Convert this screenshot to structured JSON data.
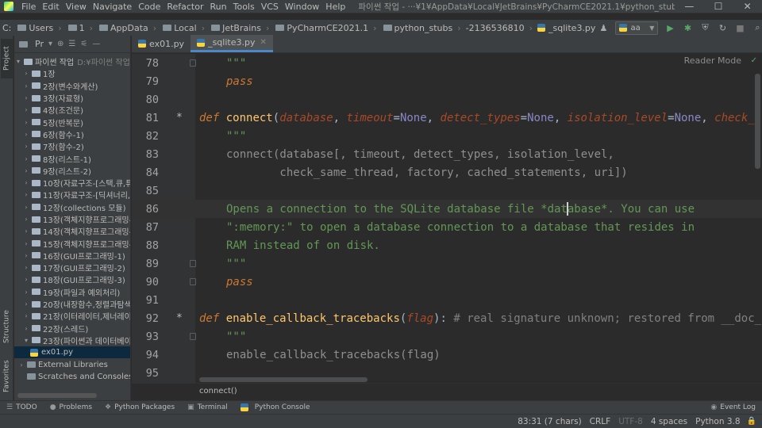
{
  "window": {
    "title": "파이썬 작업 - ···¥1¥AppData¥Local¥JetBrains¥PyCharmCE2021.1¥python_stubs¥-2136536810¥_sqlite3.py",
    "menu": [
      "File",
      "Edit",
      "View",
      "Navigate",
      "Code",
      "Refactor",
      "Run",
      "Tools",
      "VCS",
      "Window",
      "Help"
    ]
  },
  "breadcrumb": [
    "C:",
    "Users",
    "1",
    "AppData",
    "Local",
    "JetBrains",
    "PyCharmCE2021.1",
    "python_stubs",
    "-2136536810",
    "_sqlite3.py"
  ],
  "toolbar": {
    "run_config": "aa"
  },
  "left_strip": {
    "project": "Project",
    "structure": "Structure",
    "favorites": "Favorites"
  },
  "project": {
    "title": "Pr",
    "root": {
      "name": "파이썬 작업",
      "path": "D:¥파이썬 작업"
    },
    "folders": [
      "1장",
      "2장(변수와계산)",
      "3장(자료형)",
      "4장(조건문)",
      "5장(반복문)",
      "6장(함수-1)",
      "7장(함수-2)",
      "8장(리스트-1)",
      "9장(리스트-2)",
      "10장(자료구조-[스택,큐,튜플",
      "11장(자료구조-[딕셔너리,",
      "12장(collections 모듈)",
      "13장(객체지향프로그래밍-",
      "14장(객체지향프로그래밍-",
      "15장(객체지향프로그래밍-",
      "16장(GUI프로그래밍-1)",
      "17장(GUI프로그래밍-2)",
      "18장(GUI프로그래밍-3)",
      "19장(파일과 예외처리)",
      "20장(내장함수,정렬과탐색,",
      "21장(이터레이터,제너레이터",
      "22장(스레드)",
      "23장(파이썬과 데이터베이스"
    ],
    "selected_file": "ex01.py",
    "external": "External Libraries",
    "scratches": "Scratches and Consoles"
  },
  "tabs": [
    {
      "label": "ex01.py"
    },
    {
      "label": "_sqlite3.py"
    }
  ],
  "editor": {
    "reader_mode": "Reader Mode",
    "breadcrumb_func": "connect()",
    "line_numbers": [
      "78",
      "79",
      "80",
      "81",
      "82",
      "83",
      "84",
      "85",
      "86",
      "87",
      "88",
      "89",
      "90",
      "91",
      "92",
      "93",
      "94",
      "95"
    ],
    "lines": {
      "l78": "\"\"\"",
      "l79": "pass",
      "l81_def": "def",
      "l81_name": "connect",
      "l81_p1": "database",
      "l81_p2": "timeout",
      "l81_p3": "detect_types",
      "l81_p4": "isolation_level",
      "l81_p5": "check_s",
      "l81_none": "None",
      "l82": "\"\"\"",
      "l83": "connect(database[, timeout, detect_types, isolation_level,",
      "l84": "        check_same_thread, factory, cached_statements, uri])",
      "l86": "Opens a connection to the SQLite database file *database*. You can use",
      "l87": "\":memory:\" to open a database connection to a database that resides in",
      "l88": "RAM instead of on disk.",
      "l89": "\"\"\"",
      "l90": "pass",
      "l92_def": "def",
      "l92_name": "enable_callback_tracebacks",
      "l92_param": "flag",
      "l92_comment": "# real signature unknown; restored from __doc_",
      "l93": "\"\"\"",
      "l94": "enable_callback_tracebacks(flag)"
    }
  },
  "bottom_tools": [
    "TODO",
    "Problems",
    "Python Packages",
    "Terminal",
    "Python Console"
  ],
  "event_log": "Event Log",
  "status": {
    "position": "83:31 (7 chars)",
    "line_sep": "CRLF",
    "encoding": "UTF-8",
    "indent": "4 spaces",
    "interpreter": "Python 3.8"
  }
}
